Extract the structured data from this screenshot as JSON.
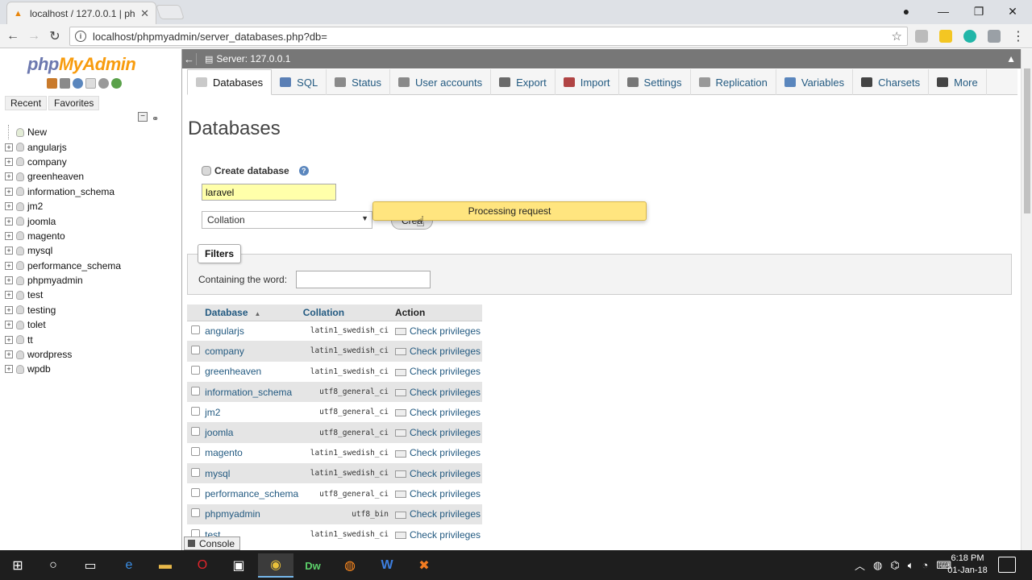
{
  "browser": {
    "tab_title": "localhost / 127.0.0.1 | ph",
    "url": "localhost/phpmyadmin/server_databases.php?db="
  },
  "sidebar": {
    "logo_php": "php",
    "logo_myadmin": "MyAdmin",
    "recent_label": "Recent",
    "favorites_label": "Favorites",
    "new_label": "New",
    "databases": [
      "angularjs",
      "company",
      "greenheaven",
      "information_schema",
      "jm2",
      "joomla",
      "magento",
      "mysql",
      "performance_schema",
      "phpmyadmin",
      "test",
      "testing",
      "tolet",
      "tt",
      "wordpress",
      "wpdb"
    ]
  },
  "server_bar": {
    "label": "Server: 127.0.0.1"
  },
  "tabs": [
    {
      "label": "Databases",
      "icon": "database-icon",
      "color": "#c9c9c9"
    },
    {
      "label": "SQL",
      "icon": "sql-icon",
      "color": "#5a7fb5"
    },
    {
      "label": "Status",
      "icon": "status-icon",
      "color": "#8a8a8a"
    },
    {
      "label": "User accounts",
      "icon": "users-icon",
      "color": "#8a8a8a"
    },
    {
      "label": "Export",
      "icon": "export-icon",
      "color": "#6a6a6a"
    },
    {
      "label": "Import",
      "icon": "import-icon",
      "color": "#b04444"
    },
    {
      "label": "Settings",
      "icon": "wrench-icon",
      "color": "#777777"
    },
    {
      "label": "Replication",
      "icon": "replication-icon",
      "color": "#999999"
    },
    {
      "label": "Variables",
      "icon": "variables-icon",
      "color": "#5a86bd"
    },
    {
      "label": "Charsets",
      "icon": "charsets-icon",
      "color": "#444444"
    },
    {
      "label": "More",
      "icon": "chevron-down-icon",
      "color": "#444444"
    }
  ],
  "main": {
    "title": "Databases",
    "create_db_label": "Create database",
    "db_name_value": "laravel",
    "collation_placeholder": "Collation",
    "create_button": "Crea",
    "processing_text": "Processing request",
    "filters_legend": "Filters",
    "filter_label": "Containing the word:",
    "filter_value": ""
  },
  "table": {
    "headers": {
      "database": "Database",
      "collation": "Collation",
      "action": "Action"
    },
    "rows": [
      {
        "name": "angularjs",
        "collation": "latin1_swedish_ci",
        "action": "Check privileges"
      },
      {
        "name": "company",
        "collation": "latin1_swedish_ci",
        "action": "Check privileges"
      },
      {
        "name": "greenheaven",
        "collation": "latin1_swedish_ci",
        "action": "Check privileges"
      },
      {
        "name": "information_schema",
        "collation": "utf8_general_ci",
        "action": "Check privileges"
      },
      {
        "name": "jm2",
        "collation": "utf8_general_ci",
        "action": "Check privileges"
      },
      {
        "name": "joomla",
        "collation": "utf8_general_ci",
        "action": "Check privileges"
      },
      {
        "name": "magento",
        "collation": "latin1_swedish_ci",
        "action": "Check privileges"
      },
      {
        "name": "mysql",
        "collation": "latin1_swedish_ci",
        "action": "Check privileges"
      },
      {
        "name": "performance_schema",
        "collation": "utf8_general_ci",
        "action": "Check privileges"
      },
      {
        "name": "phpmyadmin",
        "collation": "utf8_bin",
        "action": "Check privileges"
      },
      {
        "name": "test",
        "collation": "latin1_swedish_ci",
        "action": "Check privileges"
      }
    ]
  },
  "console": {
    "label": "Console"
  },
  "taskbar": {
    "time": "6:18 PM",
    "date": "01-Jan-18"
  }
}
